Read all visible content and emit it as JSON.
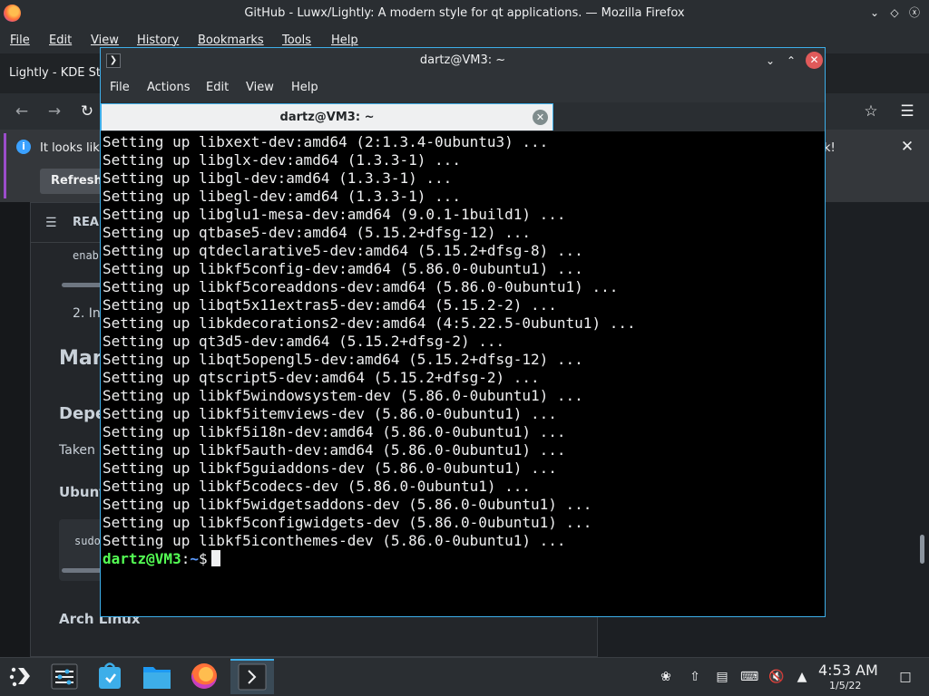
{
  "firefox": {
    "window_title": "GitHub - Luwx/Lightly: A modern style for qt applications. — Mozilla Firefox",
    "menu": [
      "File",
      "Edit",
      "View",
      "History",
      "Bookmarks",
      "Tools",
      "Help"
    ],
    "tab_label": "Lightly - KDE Sto",
    "info_bar": {
      "text": "It looks lik",
      "text_tail": "k!",
      "button": "Refresh F"
    },
    "readme": {
      "header": "REA",
      "line_enab": "enab",
      "line_install": "2. In",
      "heading_man": "Man",
      "heading_dep": "Depe",
      "text_taken": "Taken",
      "heading_ubuntu": "Ubunt",
      "code_sudo": "sudo",
      "heading_arch": "Arch Linux"
    }
  },
  "konsole": {
    "window_title": "dartz@VM3: ~",
    "menu": [
      "File",
      "Actions",
      "Edit",
      "View",
      "Help"
    ],
    "tab_label": "dartz@VM3: ~",
    "lines": [
      "Setting up libxext-dev:amd64 (2:1.3.4-0ubuntu3) ...",
      "Setting up libglx-dev:amd64 (1.3.3-1) ...",
      "Setting up libgl-dev:amd64 (1.3.3-1) ...",
      "Setting up libegl-dev:amd64 (1.3.3-1) ...",
      "Setting up libglu1-mesa-dev:amd64 (9.0.1-1build1) ...",
      "Setting up qtbase5-dev:amd64 (5.15.2+dfsg-12) ...",
      "Setting up qtdeclarative5-dev:amd64 (5.15.2+dfsg-8) ...",
      "Setting up libkf5config-dev:amd64 (5.86.0-0ubuntu1) ...",
      "Setting up libkf5coreaddons-dev:amd64 (5.86.0-0ubuntu1) ...",
      "Setting up libqt5x11extras5-dev:amd64 (5.15.2-2) ...",
      "Setting up libkdecorations2-dev:amd64 (4:5.22.5-0ubuntu1) ...",
      "Setting up qt3d5-dev:amd64 (5.15.2+dfsg-2) ...",
      "Setting up libqt5opengl5-dev:amd64 (5.15.2+dfsg-12) ...",
      "Setting up qtscript5-dev:amd64 (5.15.2+dfsg-2) ...",
      "Setting up libkf5windowsystem-dev (5.86.0-0ubuntu1) ...",
      "Setting up libkf5itemviews-dev (5.86.0-0ubuntu1) ...",
      "Setting up libkf5i18n-dev:amd64 (5.86.0-0ubuntu1) ...",
      "Setting up libkf5auth-dev:amd64 (5.86.0-0ubuntu1) ...",
      "Setting up libkf5guiaddons-dev (5.86.0-0ubuntu1) ...",
      "Setting up libkf5codecs-dev (5.86.0-0ubuntu1) ...",
      "Setting up libkf5widgetsaddons-dev (5.86.0-0ubuntu1) ...",
      "Setting up libkf5configwidgets-dev (5.86.0-0ubuntu1) ...",
      "Setting up libkf5iconthemes-dev (5.86.0-0ubuntu1) ..."
    ],
    "prompt_user": "dartz@VM3",
    "prompt_sep": ":",
    "prompt_path": "~",
    "prompt_symbol": "$"
  },
  "panel": {
    "time": "4:53 AM",
    "date": "1/5/22"
  },
  "colors": {
    "accent": "#3daee9",
    "prompt_user": "#54ff54",
    "prompt_path": "#5c9cff",
    "close": "#e05a5a"
  },
  "icons": {
    "firefox": "firefox-logo-icon",
    "info": "info-icon",
    "terminal": "terminal-icon"
  }
}
